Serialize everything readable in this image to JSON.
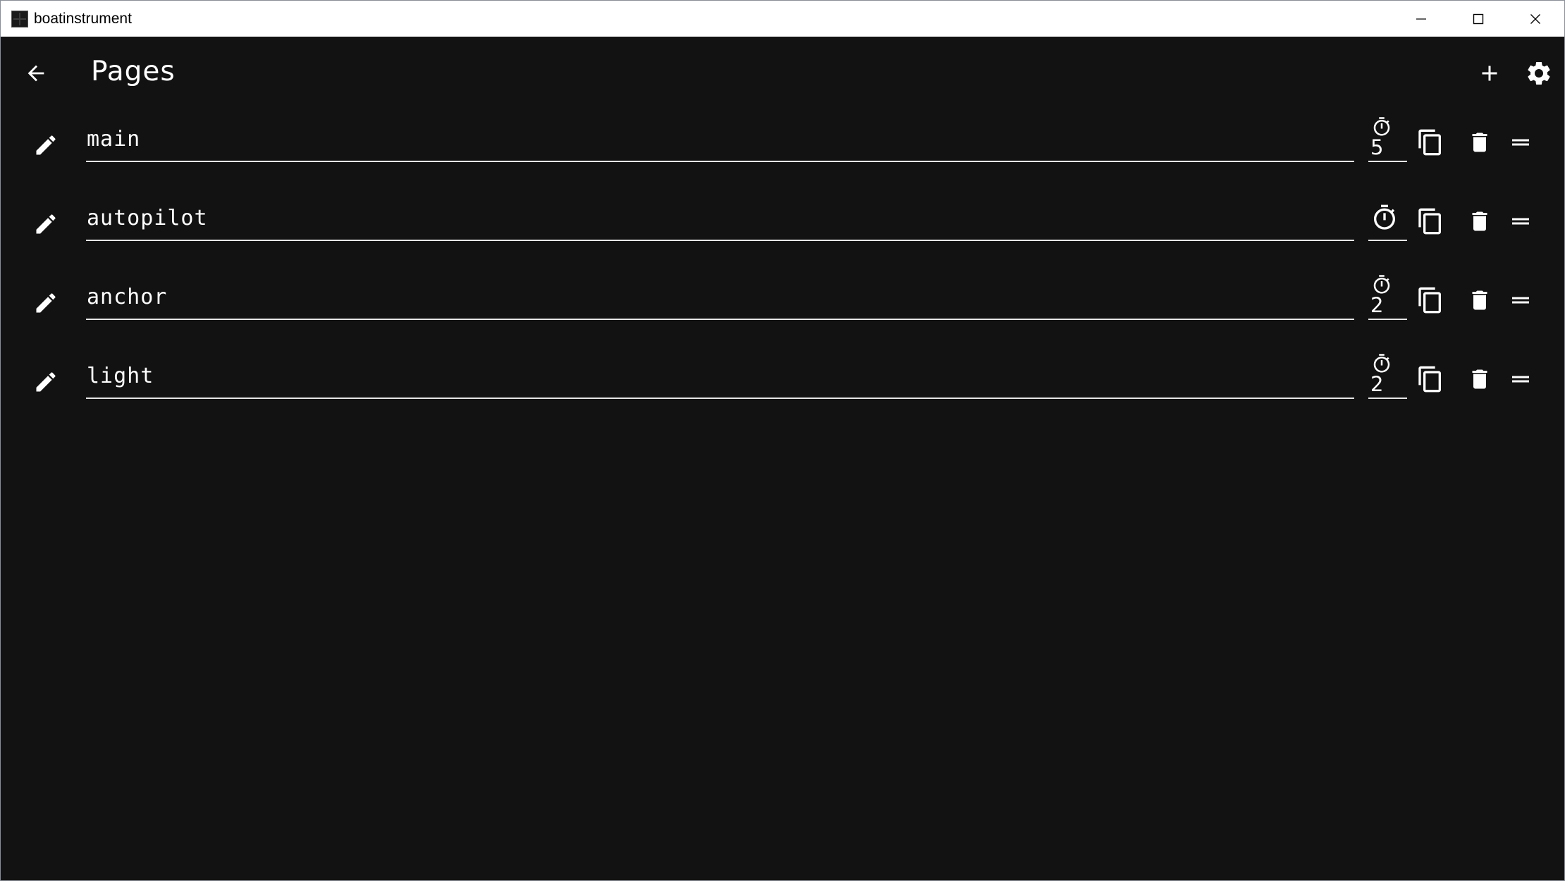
{
  "window": {
    "title": "boatinstrument",
    "icons": {
      "app": "app-icon",
      "minimize": "minimize-icon",
      "maximize": "maximize-icon",
      "close": "close-icon"
    }
  },
  "appbar": {
    "title": "Pages",
    "icons": {
      "back": "arrow-back-icon",
      "add": "plus-icon",
      "settings": "gear-icon"
    }
  },
  "colors": {
    "background": "#121212",
    "foreground": "#ffffff",
    "underline": "#e6e6e6",
    "titlebar": "#ffffff"
  },
  "pages": [
    {
      "name": "main",
      "timer": "5"
    },
    {
      "name": "autopilot",
      "timer": ""
    },
    {
      "name": "anchor",
      "timer": "2"
    },
    {
      "name": "light",
      "timer": "2"
    }
  ],
  "row_icons": {
    "edit": "pencil-icon",
    "timer": "timer-icon",
    "copy": "copy-icon",
    "delete": "trash-icon",
    "reorder": "drag-handle-icon"
  }
}
